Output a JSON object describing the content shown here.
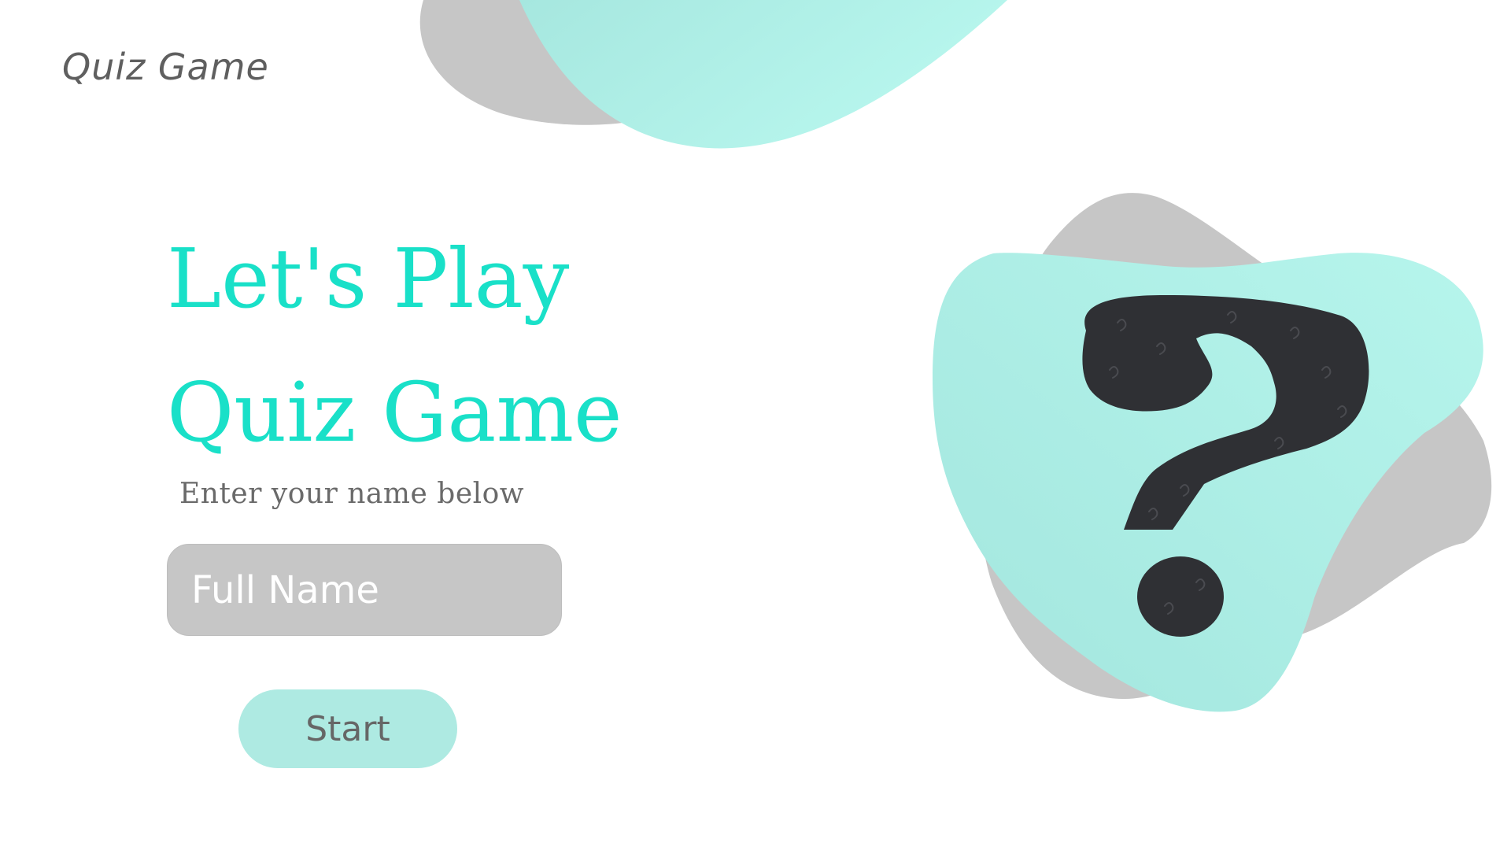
{
  "app": {
    "logo_text": "Quiz Game"
  },
  "hero": {
    "headline_line1": "Let's Play",
    "headline_line2": "Quiz Game",
    "subtitle": "Enter your name below"
  },
  "form": {
    "name_placeholder": "Full Name",
    "name_value": "",
    "start_label": "Start"
  },
  "illustration": {
    "icon": "question-mark-icon"
  },
  "colors": {
    "accent": "#19e0c8",
    "blob_mint": "#aeeae2",
    "blob_gray": "#c6c6c6",
    "icon_dark": "#2f3034",
    "text_gray": "#6a6a6a"
  }
}
